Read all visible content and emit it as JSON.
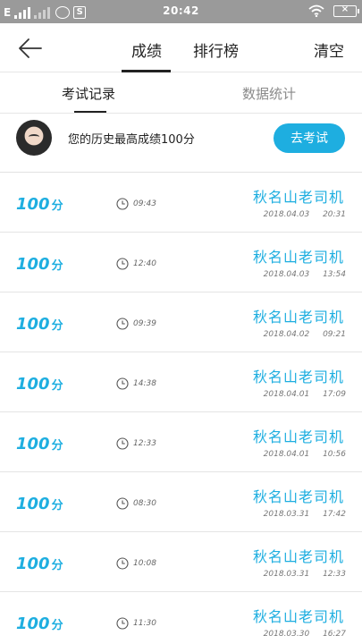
{
  "status_bar": {
    "carrier": "E",
    "time": "20:42",
    "icons": [
      "signal-icon",
      "signal-icon",
      "wechat-icon",
      "s-app-icon",
      "wifi-icon",
      "battery-icon"
    ]
  },
  "header": {
    "tabs": [
      "成绩",
      "排行榜"
    ],
    "active_tab": "成绩",
    "clear_label": "清空"
  },
  "subtabs": {
    "items": [
      "考试记录",
      "数据统计"
    ],
    "active": "考试记录"
  },
  "summary": {
    "text": "您的历史最高成绩100分",
    "button_label": "去考试"
  },
  "records": [
    {
      "score": "100",
      "unit": "分",
      "duration": "09:43",
      "name": "秋名山老司机",
      "date": "2018.04.03 20:31"
    },
    {
      "score": "100",
      "unit": "分",
      "duration": "12:40",
      "name": "秋名山老司机",
      "date": "2018.04.03 13:54"
    },
    {
      "score": "100",
      "unit": "分",
      "duration": "09:39",
      "name": "秋名山老司机",
      "date": "2018.04.02 09:21"
    },
    {
      "score": "100",
      "unit": "分",
      "duration": "14:38",
      "name": "秋名山老司机",
      "date": "2018.04.01 17:09"
    },
    {
      "score": "100",
      "unit": "分",
      "duration": "12:33",
      "name": "秋名山老司机",
      "date": "2018.04.01 10:56"
    },
    {
      "score": "100",
      "unit": "分",
      "duration": "08:30",
      "name": "秋名山老司机",
      "date": "2018.03.31 17:42"
    },
    {
      "score": "100",
      "unit": "分",
      "duration": "10:08",
      "name": "秋名山老司机",
      "date": "2018.03.31 12:33"
    },
    {
      "score": "100",
      "unit": "分",
      "duration": "11:30",
      "name": "秋名山老司机",
      "date": "2018.03.30 16:27"
    }
  ],
  "colors": {
    "accent": "#1eaee0",
    "status_bar": "#9a9a9a",
    "text": "#222222"
  }
}
